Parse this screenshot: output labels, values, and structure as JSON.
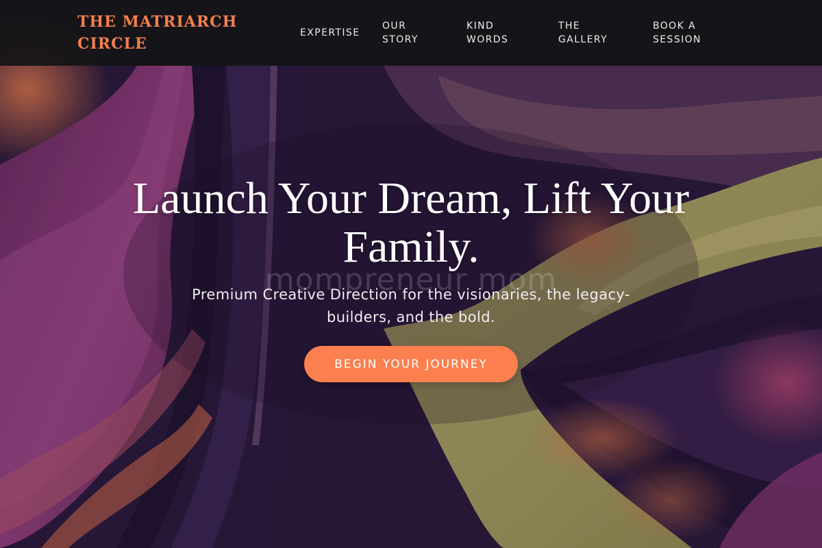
{
  "brand": {
    "name": "THE MATRIARCH\nCIRCLE",
    "color": "#f47f4e"
  },
  "nav": {
    "items": [
      {
        "label": "EXPERTISE"
      },
      {
        "label": "OUR\nSTORY"
      },
      {
        "label": "KIND\nWORDS"
      },
      {
        "label": "THE\nGALLERY"
      },
      {
        "label": "BOOK A\nSESSION"
      }
    ]
  },
  "hero": {
    "title": "Launch Your Dream, Lift Your Family.",
    "watermark": "mompreneur mom",
    "subtitle": "Premium Creative Direction for the visionaries, the legacy-builders, and the bold.",
    "cta_label": "BEGIN YOUR JOURNEY",
    "cta_color": "#fb7f4f"
  },
  "colors": {
    "nav_background": "#151516",
    "deep_purple": "#2a1838",
    "magenta": "#8a3a80",
    "olive": "#a5a060",
    "orange_glow": "#d9704a"
  }
}
